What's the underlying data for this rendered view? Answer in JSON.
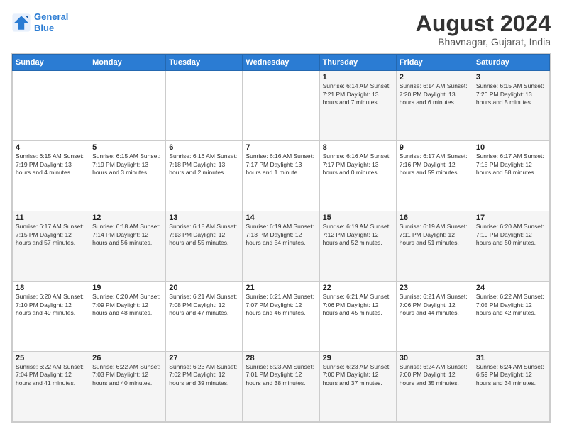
{
  "logo": {
    "line1": "General",
    "line2": "Blue"
  },
  "header": {
    "month_year": "August 2024",
    "location": "Bhavnagar, Gujarat, India"
  },
  "weekdays": [
    "Sunday",
    "Monday",
    "Tuesday",
    "Wednesday",
    "Thursday",
    "Friday",
    "Saturday"
  ],
  "weeks": [
    [
      {
        "day": "",
        "info": ""
      },
      {
        "day": "",
        "info": ""
      },
      {
        "day": "",
        "info": ""
      },
      {
        "day": "",
        "info": ""
      },
      {
        "day": "1",
        "info": "Sunrise: 6:14 AM\nSunset: 7:21 PM\nDaylight: 13 hours\nand 7 minutes."
      },
      {
        "day": "2",
        "info": "Sunrise: 6:14 AM\nSunset: 7:20 PM\nDaylight: 13 hours\nand 6 minutes."
      },
      {
        "day": "3",
        "info": "Sunrise: 6:15 AM\nSunset: 7:20 PM\nDaylight: 13 hours\nand 5 minutes."
      }
    ],
    [
      {
        "day": "4",
        "info": "Sunrise: 6:15 AM\nSunset: 7:19 PM\nDaylight: 13 hours\nand 4 minutes."
      },
      {
        "day": "5",
        "info": "Sunrise: 6:15 AM\nSunset: 7:19 PM\nDaylight: 13 hours\nand 3 minutes."
      },
      {
        "day": "6",
        "info": "Sunrise: 6:16 AM\nSunset: 7:18 PM\nDaylight: 13 hours\nand 2 minutes."
      },
      {
        "day": "7",
        "info": "Sunrise: 6:16 AM\nSunset: 7:17 PM\nDaylight: 13 hours\nand 1 minute."
      },
      {
        "day": "8",
        "info": "Sunrise: 6:16 AM\nSunset: 7:17 PM\nDaylight: 13 hours\nand 0 minutes."
      },
      {
        "day": "9",
        "info": "Sunrise: 6:17 AM\nSunset: 7:16 PM\nDaylight: 12 hours\nand 59 minutes."
      },
      {
        "day": "10",
        "info": "Sunrise: 6:17 AM\nSunset: 7:15 PM\nDaylight: 12 hours\nand 58 minutes."
      }
    ],
    [
      {
        "day": "11",
        "info": "Sunrise: 6:17 AM\nSunset: 7:15 PM\nDaylight: 12 hours\nand 57 minutes."
      },
      {
        "day": "12",
        "info": "Sunrise: 6:18 AM\nSunset: 7:14 PM\nDaylight: 12 hours\nand 56 minutes."
      },
      {
        "day": "13",
        "info": "Sunrise: 6:18 AM\nSunset: 7:13 PM\nDaylight: 12 hours\nand 55 minutes."
      },
      {
        "day": "14",
        "info": "Sunrise: 6:19 AM\nSunset: 7:13 PM\nDaylight: 12 hours\nand 54 minutes."
      },
      {
        "day": "15",
        "info": "Sunrise: 6:19 AM\nSunset: 7:12 PM\nDaylight: 12 hours\nand 52 minutes."
      },
      {
        "day": "16",
        "info": "Sunrise: 6:19 AM\nSunset: 7:11 PM\nDaylight: 12 hours\nand 51 minutes."
      },
      {
        "day": "17",
        "info": "Sunrise: 6:20 AM\nSunset: 7:10 PM\nDaylight: 12 hours\nand 50 minutes."
      }
    ],
    [
      {
        "day": "18",
        "info": "Sunrise: 6:20 AM\nSunset: 7:10 PM\nDaylight: 12 hours\nand 49 minutes."
      },
      {
        "day": "19",
        "info": "Sunrise: 6:20 AM\nSunset: 7:09 PM\nDaylight: 12 hours\nand 48 minutes."
      },
      {
        "day": "20",
        "info": "Sunrise: 6:21 AM\nSunset: 7:08 PM\nDaylight: 12 hours\nand 47 minutes."
      },
      {
        "day": "21",
        "info": "Sunrise: 6:21 AM\nSunset: 7:07 PM\nDaylight: 12 hours\nand 46 minutes."
      },
      {
        "day": "22",
        "info": "Sunrise: 6:21 AM\nSunset: 7:06 PM\nDaylight: 12 hours\nand 45 minutes."
      },
      {
        "day": "23",
        "info": "Sunrise: 6:21 AM\nSunset: 7:06 PM\nDaylight: 12 hours\nand 44 minutes."
      },
      {
        "day": "24",
        "info": "Sunrise: 6:22 AM\nSunset: 7:05 PM\nDaylight: 12 hours\nand 42 minutes."
      }
    ],
    [
      {
        "day": "25",
        "info": "Sunrise: 6:22 AM\nSunset: 7:04 PM\nDaylight: 12 hours\nand 41 minutes."
      },
      {
        "day": "26",
        "info": "Sunrise: 6:22 AM\nSunset: 7:03 PM\nDaylight: 12 hours\nand 40 minutes."
      },
      {
        "day": "27",
        "info": "Sunrise: 6:23 AM\nSunset: 7:02 PM\nDaylight: 12 hours\nand 39 minutes."
      },
      {
        "day": "28",
        "info": "Sunrise: 6:23 AM\nSunset: 7:01 PM\nDaylight: 12 hours\nand 38 minutes."
      },
      {
        "day": "29",
        "info": "Sunrise: 6:23 AM\nSunset: 7:00 PM\nDaylight: 12 hours\nand 37 minutes."
      },
      {
        "day": "30",
        "info": "Sunrise: 6:24 AM\nSunset: 7:00 PM\nDaylight: 12 hours\nand 35 minutes."
      },
      {
        "day": "31",
        "info": "Sunrise: 6:24 AM\nSunset: 6:59 PM\nDaylight: 12 hours\nand 34 minutes."
      }
    ]
  ]
}
